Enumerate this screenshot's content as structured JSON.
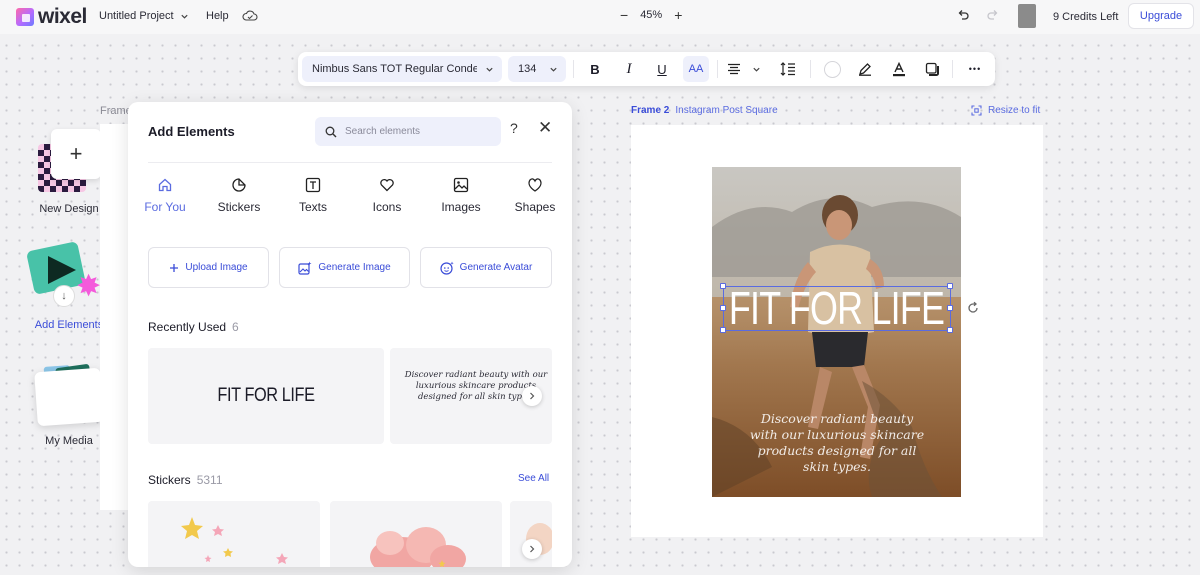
{
  "app": {
    "logo": "wixel",
    "project_name": "Untitled Project",
    "help": "Help",
    "zoom": "45%",
    "zoom_out": "−",
    "zoom_in": "+",
    "credits": "9 Credits Left",
    "upgrade": "Upgrade",
    "accent": "#3a4cd8"
  },
  "toolbar": {
    "font": "Nimbus Sans TOT Regular Condens",
    "size": "134",
    "bold": "B",
    "italic": "I",
    "underline": "U",
    "case": "AA",
    "more": "•••"
  },
  "rail": {
    "new_design": "New Design",
    "add_elements": "Add Elements",
    "my_media": "My Media",
    "frame1_label": "Frame"
  },
  "panel": {
    "title": "Add Elements",
    "search_placeholder": "Search elements",
    "help": "?",
    "close": "✕",
    "tabs": [
      {
        "label": "For You",
        "icon": "home-icon"
      },
      {
        "label": "Stickers",
        "icon": "sticker-icon"
      },
      {
        "label": "Texts",
        "icon": "text-icon"
      },
      {
        "label": "Icons",
        "icon": "heart-icon"
      },
      {
        "label": "Images",
        "icon": "image-icon"
      },
      {
        "label": "Shapes",
        "icon": "shapes-icon"
      }
    ],
    "actions": [
      {
        "label": "Upload Image",
        "icon": "plus-icon"
      },
      {
        "label": "Generate Image",
        "icon": "ai-image-icon"
      },
      {
        "label": "Generate Avatar",
        "icon": "ai-avatar-icon"
      }
    ],
    "recently_used": {
      "title": "Recently Used",
      "count": "6"
    },
    "recent_items": {
      "fit": "FIT FOR LIFE",
      "quote": "Discover radiant beauty with our luxurious skincare products designed for all skin types."
    },
    "stickers": {
      "title": "Stickers",
      "count": "5311",
      "see_all": "See All"
    }
  },
  "canvas": {
    "frame_name": "Frame 2",
    "frame_type": "Instagram Post Square",
    "resize": "Resize to fit",
    "headline": "FIT FOR LIFE",
    "body_quote": "Discover radiant beauty with our luxurious skincare products designed for all skin types."
  }
}
